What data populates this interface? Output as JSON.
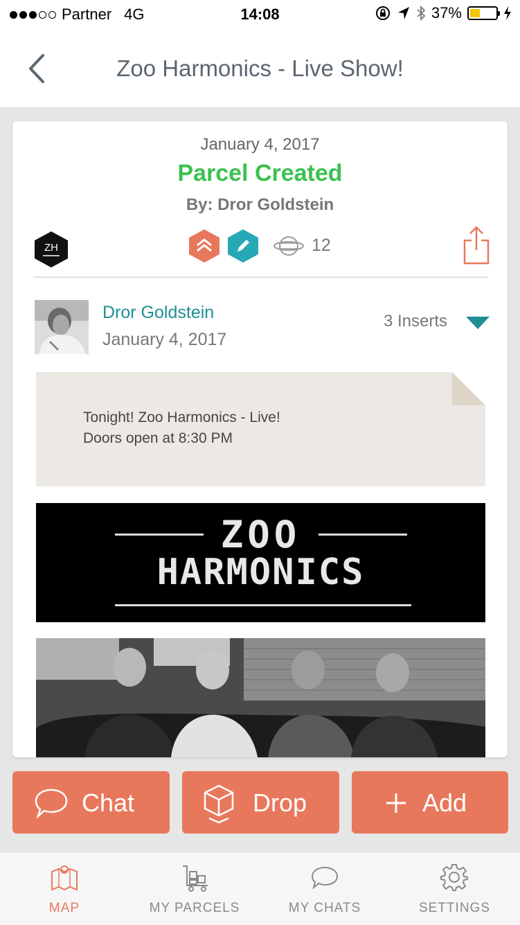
{
  "status_bar": {
    "carrier": "Partner",
    "network": "4G",
    "time": "14:08",
    "battery": "37%",
    "battery_level": 0.37
  },
  "nav": {
    "title": "Zoo Harmonics - Live Show!",
    "back_icon": "chevron-left-icon"
  },
  "parcel": {
    "date": "January 4, 2017",
    "status": "Parcel Created",
    "author_line": "By: Dror Goldstein",
    "brand_initials": "ZH",
    "views_count": "12",
    "colors": {
      "status_green": "#3cc150",
      "accent_orange": "#e8785c",
      "accent_teal": "#27a9b5"
    }
  },
  "post": {
    "author": "Dror Goldstein",
    "date": "January 4, 2017",
    "inserts": "3 Inserts",
    "note_lines": [
      "Tonight! Zoo Harmonics - Live!",
      "Doors open at 8:30 PM"
    ],
    "banner_line1": "ZOO",
    "banner_line2": "HARMONICS"
  },
  "actions": {
    "chat": "Chat",
    "drop": "Drop",
    "add": "Add"
  },
  "tabs": [
    {
      "label": "MAP",
      "icon": "map-icon",
      "active": true
    },
    {
      "label": "MY PARCELS",
      "icon": "parcels-cart-icon",
      "active": false
    },
    {
      "label": "MY CHATS",
      "icon": "chat-bubble-icon",
      "active": false
    },
    {
      "label": "SETTINGS",
      "icon": "gear-icon",
      "active": false
    }
  ]
}
